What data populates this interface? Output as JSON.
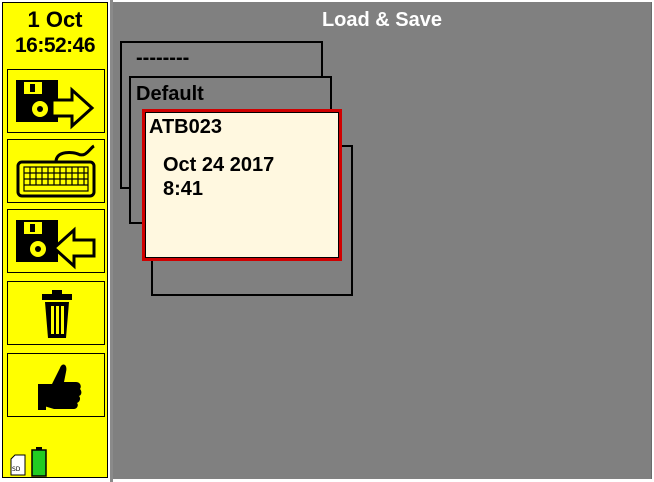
{
  "status": {
    "date": "1 Oct",
    "time": "16:52:46"
  },
  "header": {
    "title": "Load & Save"
  },
  "sidebar": {
    "buttons": [
      {
        "name": "save-to-disk",
        "icon": "floppy-disk-arrow-right-icon"
      },
      {
        "name": "keyboard",
        "icon": "keyboard-icon"
      },
      {
        "name": "load-from-disk",
        "icon": "floppy-disk-arrow-left-icon"
      },
      {
        "name": "delete",
        "icon": "trash-can-icon"
      },
      {
        "name": "confirm",
        "icon": "thumbs-up-icon"
      }
    ],
    "status_icons": [
      "sd-card-icon",
      "battery-icon"
    ]
  },
  "cards": {
    "back": {
      "label": "--------"
    },
    "middle": {
      "label": "Default"
    },
    "selected": {
      "name": "ATB023",
      "date": "Oct 24 2017",
      "time": "8:41"
    }
  },
  "colors": {
    "sidebar": "#ffff00",
    "background": "#808080",
    "selected_border": "#d00000",
    "selected_fill": "#fff8e0",
    "battery": "#22cc22"
  }
}
